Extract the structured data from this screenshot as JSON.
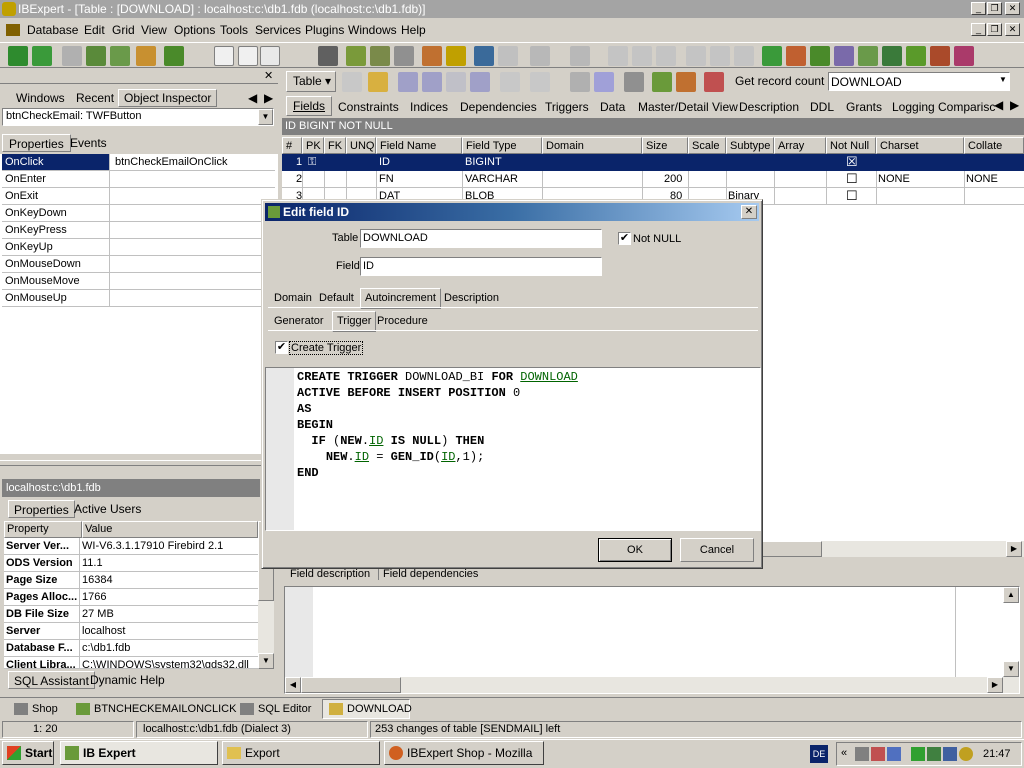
{
  "window": {
    "title": "IBExpert - [Table : [DOWNLOAD] : localhost:c:\\db1.fdb (localhost:c:\\db1.fdb)]"
  },
  "menu": [
    "Database",
    "Edit",
    "Grid",
    "View",
    "Options",
    "Tools",
    "Services",
    "Plugins",
    "Windows",
    "Help"
  ],
  "left_panel": {
    "tabs": [
      "Windows",
      "Recent",
      "Object Inspector"
    ],
    "selector": "btnCheckEmail: TWFButton",
    "subtabs": [
      "Properties",
      "Events"
    ],
    "events": [
      {
        "name": "OnClick",
        "value": "btnCheckEmailOnClick"
      },
      {
        "name": "OnEnter",
        "value": ""
      },
      {
        "name": "OnExit",
        "value": ""
      },
      {
        "name": "OnKeyDown",
        "value": ""
      },
      {
        "name": "OnKeyPress",
        "value": ""
      },
      {
        "name": "OnKeyUp",
        "value": ""
      },
      {
        "name": "OnMouseDown",
        "value": ""
      },
      {
        "name": "OnMouseMove",
        "value": ""
      },
      {
        "name": "OnMouseUp",
        "value": ""
      }
    ],
    "db_title": "localhost:c:\\db1.fdb",
    "db_tabs": [
      "Properties",
      "Active Users"
    ],
    "db_headers": [
      "Property",
      "Value"
    ],
    "db_props": [
      {
        "k": "Server Ver...",
        "v": "WI-V6.3.1.17910 Firebird 2.1"
      },
      {
        "k": "ODS Version",
        "v": "11.1"
      },
      {
        "k": "Page Size",
        "v": "16384"
      },
      {
        "k": "Pages Alloc...",
        "v": "1766"
      },
      {
        "k": "DB File Size",
        "v": "27 MB"
      },
      {
        "k": "Server",
        "v": "localhost"
      },
      {
        "k": "Database F...",
        "v": "c:\\db1.fdb"
      },
      {
        "k": "Client Libra...",
        "v": "C:\\WINDOWS\\system32\\gds32.dll"
      }
    ],
    "bottom_tabs": [
      "SQL Assistant",
      "Dynamic Help"
    ]
  },
  "table_toolbar": {
    "table_btn": "Table",
    "get_record": "Get record count",
    "table_name": "DOWNLOAD"
  },
  "table_tabs": [
    "Fields",
    "Constraints",
    "Indices",
    "Dependencies",
    "Triggers",
    "Data",
    "Master/Detail View",
    "Description",
    "DDL",
    "Grants",
    "Logging",
    "Comparisc"
  ],
  "field_caption": "ID BIGINT NOT NULL",
  "grid": {
    "headers": [
      "#",
      "PK",
      "FK",
      "UNQ",
      "Field Name",
      "Field Type",
      "Domain",
      "Size",
      "Scale",
      "Subtype",
      "Array",
      "Not Null",
      "Charset",
      "Collate"
    ],
    "rows": [
      {
        "n": "1",
        "name": "ID",
        "type": "BIGINT",
        "size": "",
        "subtype": "",
        "notnull": "☒",
        "charset": "",
        "collate": ""
      },
      {
        "n": "2",
        "name": "FN",
        "type": "VARCHAR",
        "size": "200",
        "subtype": "",
        "notnull": "☐",
        "charset": "NONE",
        "collate": "NONE"
      },
      {
        "n": "3",
        "name": "DAT",
        "type": "BLOB",
        "size": "80",
        "subtype": "Binary",
        "notnull": "☐",
        "charset": "",
        "collate": ""
      }
    ]
  },
  "bottom_tabs": [
    "Field description",
    "Field dependencies"
  ],
  "dialog": {
    "title": "Edit field ID",
    "table_label": "Table",
    "table_value": "DOWNLOAD",
    "notnull_label": "Not NULL",
    "field_label": "Field",
    "field_value": "ID",
    "tabs": [
      "Domain",
      "Default",
      "Autoincrement",
      "Description"
    ],
    "subtabs": [
      "Generator",
      "Trigger",
      "Procedure"
    ],
    "create_trigger": "Create Trigger",
    "ok": "OK",
    "cancel": "Cancel"
  },
  "window_tabs": [
    "Shop",
    "BTNCHECKEMAILONCLICK",
    "SQL Editor",
    "DOWNLOAD"
  ],
  "status": {
    "pos": "1:  20",
    "db": "localhost:c:\\db1.fdb (Dialect 3)",
    "msg": "253 changes of table [SENDMAIL] left"
  },
  "taskbar": {
    "start": "Start",
    "items": [
      "IB Expert",
      "Export",
      "IBExpert Shop - Mozilla F..."
    ],
    "lang": "DE",
    "time": "21:47"
  }
}
